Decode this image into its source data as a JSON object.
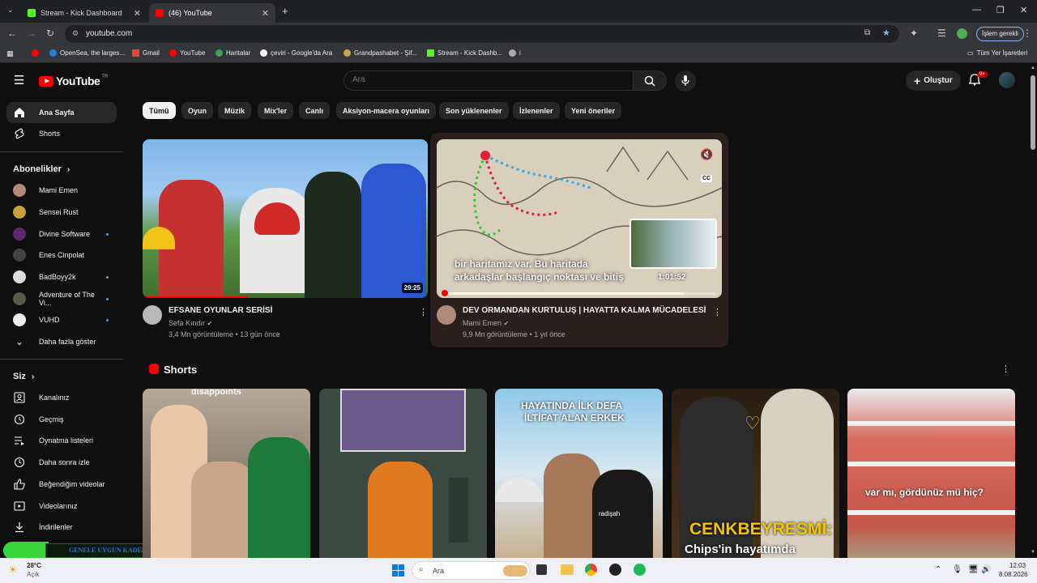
{
  "browser": {
    "tabs": [
      {
        "title": "Stream - Kick Dashboard",
        "active": false
      },
      {
        "title": "(46) YouTube",
        "active": true
      }
    ],
    "new_tab_symbol": "+",
    "url": "youtube.com",
    "profile_chip": "İşlem gerekli",
    "bookmarks": [
      {
        "label": "",
        "icon": "youtube-icon"
      },
      {
        "label": "OpenSea, the larges...",
        "icon": "opensea-icon"
      },
      {
        "label": "Gmail",
        "icon": "gmail-icon"
      },
      {
        "label": "YouTube",
        "icon": "youtube-icon"
      },
      {
        "label": "Haritalar",
        "icon": "maps-icon"
      },
      {
        "label": "çeviri - Google'da Ara",
        "icon": "google-icon"
      },
      {
        "label": "Grandpashabet - Şif...",
        "icon": "bet-icon"
      },
      {
        "label": "Stream - Kick Dashb...",
        "icon": "kick-icon"
      },
      {
        "label": "i",
        "icon": "page-icon"
      }
    ],
    "all_bookmarks": "Tüm Yer İşaretleri"
  },
  "header": {
    "logo_text": "YouTube",
    "logo_region": "TR",
    "search_placeholder": "Ara",
    "create_label": "Oluştur",
    "notification_count": "9+"
  },
  "sidebar": {
    "main": [
      {
        "label": "Ana Sayfa",
        "icon": "home-icon",
        "active": true
      },
      {
        "label": "Shorts",
        "icon": "shorts-icon",
        "active": false
      }
    ],
    "subscriptions_heading": "Abonelikler",
    "subscriptions": [
      {
        "label": "Mami Emen",
        "dot": false,
        "color": "#b08a7a"
      },
      {
        "label": "Sensei Rust",
        "dot": false,
        "color": "#c7a23a"
      },
      {
        "label": "Divine Software",
        "dot": true,
        "color": "#5a2a6a"
      },
      {
        "label": "Enes Cinpolat",
        "dot": false,
        "color": "#444444"
      },
      {
        "label": "BadBoyy2k",
        "dot": true,
        "color": "#ddd"
      },
      {
        "label": "Adventure of The Vi...",
        "dot": true,
        "color": "#5a5a4a"
      },
      {
        "label": "VUHD",
        "dot": true,
        "color": "#eee"
      }
    ],
    "show_more": "Daha fazla göster",
    "you_heading": "Siz",
    "you_items": [
      {
        "label": "Kanalınız",
        "icon": "channel-icon"
      },
      {
        "label": "Geçmiş",
        "icon": "history-icon"
      },
      {
        "label": "Oynatma listeleri",
        "icon": "playlist-icon"
      },
      {
        "label": "Daha sonra izle",
        "icon": "watch-later-icon"
      },
      {
        "label": "Beğendiğim videolar",
        "icon": "like-icon"
      },
      {
        "label": "Videolarınız",
        "icon": "your-videos-icon"
      },
      {
        "label": "İndirilenler",
        "icon": "download-icon"
      }
    ],
    "overlay_banner": "GENELE UYGUN KADEFİ"
  },
  "chips": [
    "Tümü",
    "Oyun",
    "Müzik",
    "Mix'ler",
    "Canlı",
    "Aksiyon-macera oyunları",
    "Son yüklenenler",
    "İzlenenler",
    "Yeni öneriler"
  ],
  "videos": [
    {
      "title": "EFSANE OYUNLAR SERİSİ",
      "channel": "Sefa Kındır",
      "meta": "3,4 Mn görüntüleme • 13 gün önce",
      "duration": "29:25"
    },
    {
      "title": "DEV ORMANDAN KURTULUŞ  | HAYATTA KALMA MÜCADELESİ",
      "channel": "Mami Emen",
      "meta": "9,9 Mn görüntüleme • 1 yıl önce",
      "caption_line1": "bir haritamız var. Bu haritada",
      "caption_line2": "arkadaşlar başlangıç noktası ve bitiş",
      "preview_time": "1:01:52",
      "cc": "CC"
    }
  ],
  "shorts": {
    "heading": "Shorts",
    "items": [
      {
        "caption": "disappoints"
      },
      {
        "caption": ""
      },
      {
        "caption": "HAYATINDA İLK DEFA İLTİFAT ALAN ERKEK",
        "line1": "HAYATINDA İLK DEFA",
        "line2": "İLTİFAT ALAN ERKEK",
        "shirt": "radişah"
      },
      {
        "caption": "CENKBEYRESMİ:",
        "line1": "CENKBEYRESMİ:",
        "line2": "Chips'in hayatımda"
      },
      {
        "caption": "var mı, gördünüz mü hiç?"
      }
    ]
  },
  "taskbar": {
    "weather_temp": "28°C",
    "weather_desc": "Açık",
    "search_placeholder": "Ara",
    "time": "12:03",
    "date": "8.08.2026"
  }
}
